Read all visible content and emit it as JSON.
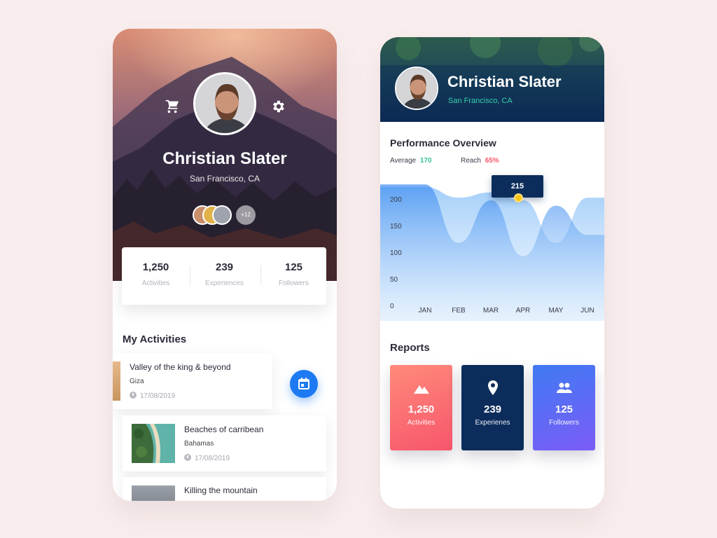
{
  "profile": {
    "name": "Christian Slater",
    "location": "San Francisco, CA",
    "friends_more": "+12"
  },
  "stats": [
    {
      "value": "1,250",
      "label": "Activities"
    },
    {
      "value": "239",
      "label": "Experiences"
    },
    {
      "value": "125",
      "label": "Followers"
    }
  ],
  "activities": {
    "title": "My Activities",
    "items": [
      {
        "title": "Valley of the king & beyond",
        "place": "Giza",
        "date": "17/08/2019"
      },
      {
        "title": "Beaches of carribean",
        "place": "Bahamas",
        "date": "17/08/2019"
      },
      {
        "title": "Killing the mountain",
        "place": "",
        "date": ""
      }
    ]
  },
  "performance": {
    "title": "Performance Overview",
    "average_label": "Average",
    "average_value": "170",
    "reach_label": "Reach",
    "reach_value": "65%",
    "tooltip": "215"
  },
  "chart_data": {
    "type": "area",
    "categories": [
      "JAN",
      "FEB",
      "MAR",
      "APR",
      "MAY",
      "JUN"
    ],
    "y_ticks": [
      "0",
      "50",
      "100",
      "150",
      "200"
    ],
    "ylim": [
      0,
      250
    ],
    "series": [
      {
        "values": [
          225,
          205,
          215,
          200,
          120,
          205
        ]
      },
      {
        "values": [
          230,
          120,
          200,
          95,
          190,
          135
        ]
      }
    ],
    "highlight": {
      "category": "MAR",
      "value": 215
    }
  },
  "reports": {
    "title": "Reports",
    "items": [
      {
        "value": "1,250",
        "label": "Activities",
        "icon": "mountain-icon"
      },
      {
        "value": "239",
        "label": "Experienes",
        "icon": "location-pin-icon"
      },
      {
        "value": "125",
        "label": "Followers",
        "icon": "people-icon"
      }
    ]
  },
  "colors": {
    "accent_blue": "#1d7af3",
    "navy": "#0c2d5c",
    "teal": "#36d0ab",
    "coral": "#f7566c"
  }
}
